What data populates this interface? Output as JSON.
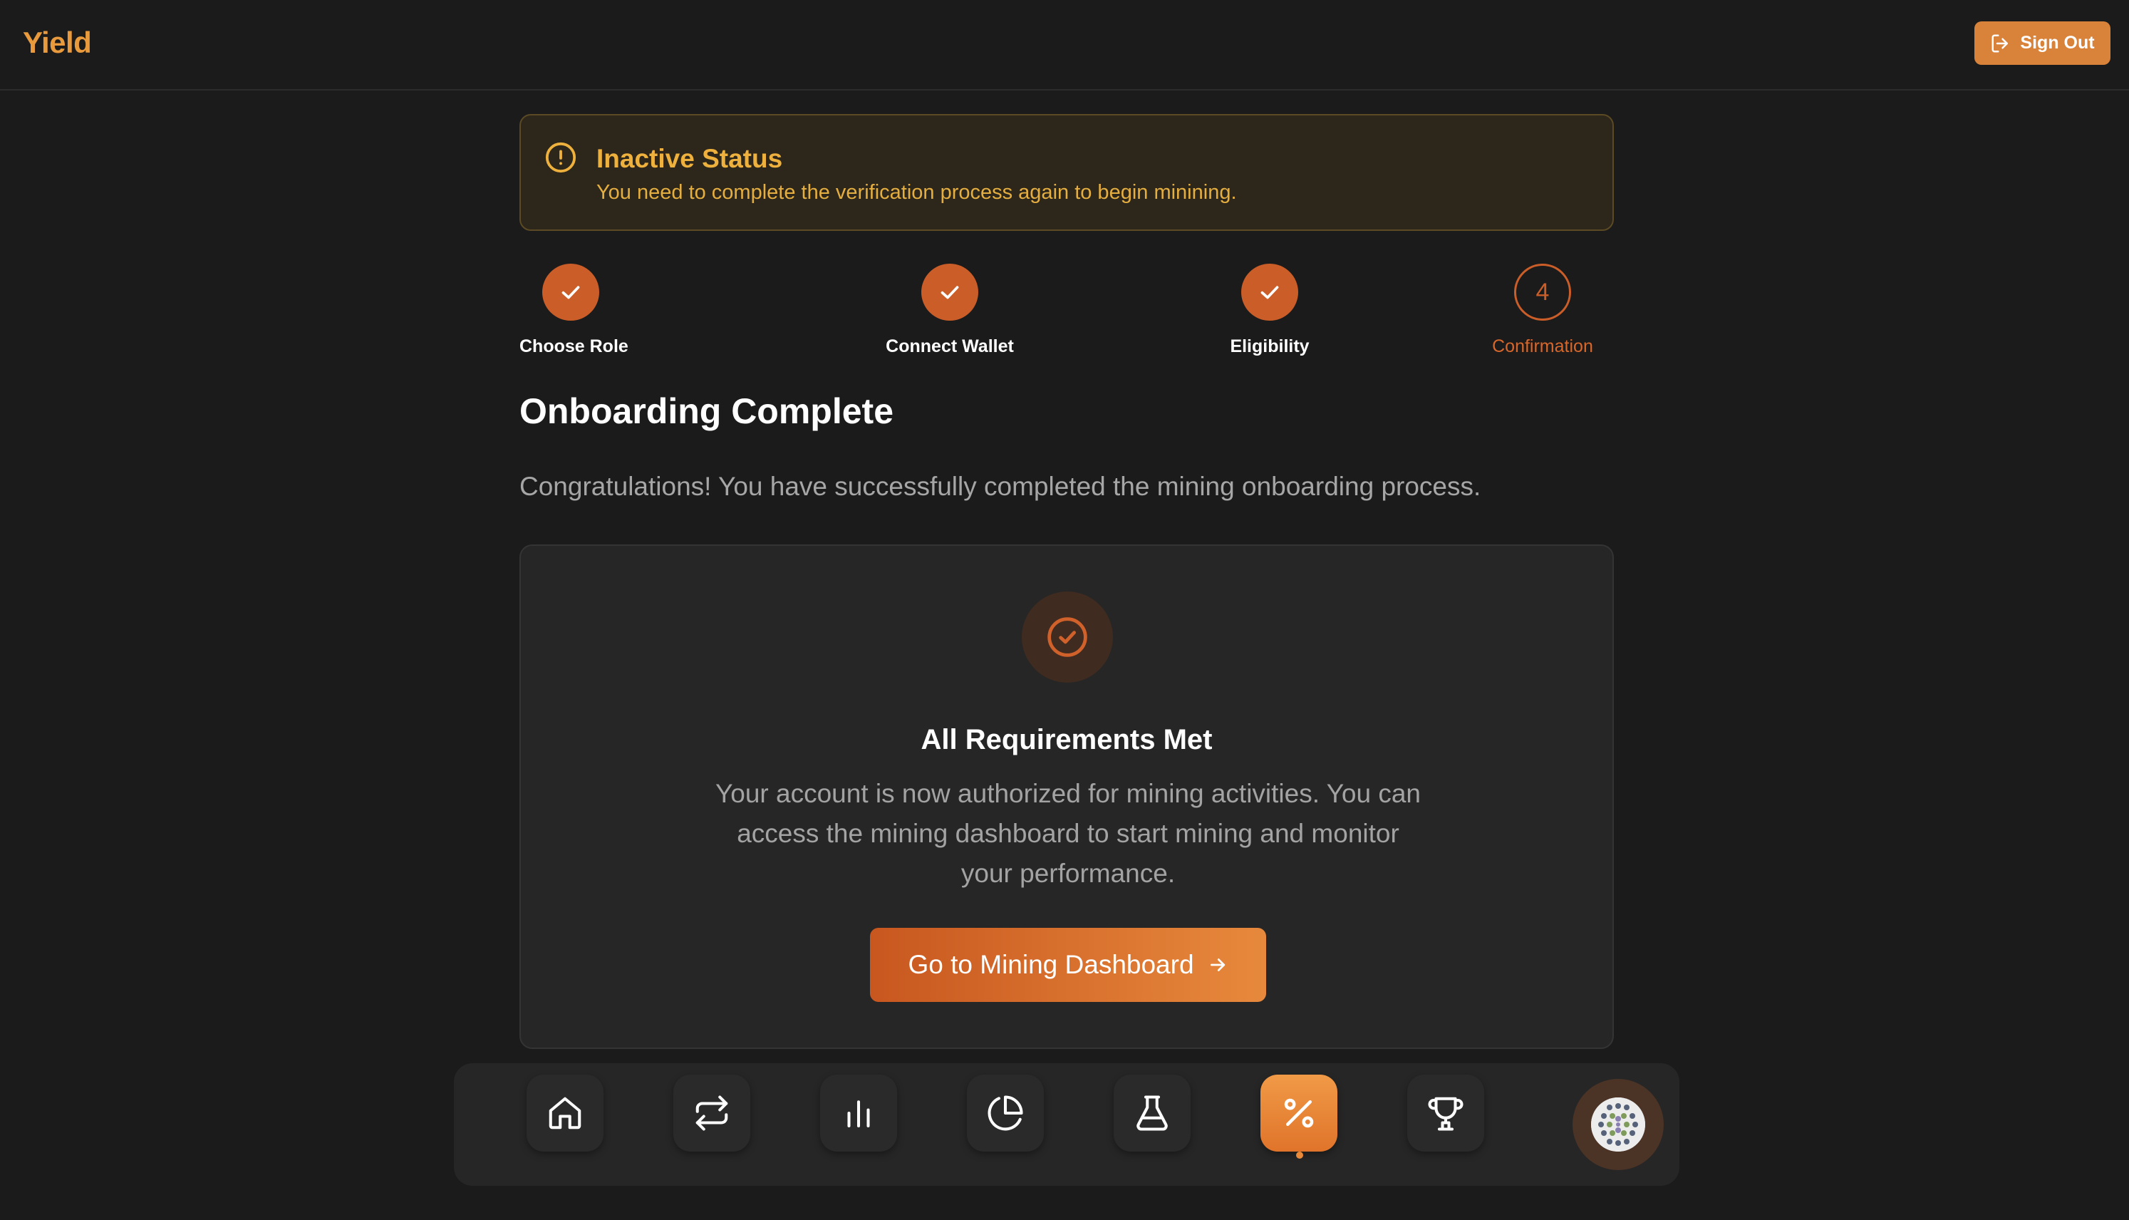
{
  "header": {
    "brand": "Yield",
    "sign_out_label": "Sign Out"
  },
  "alert": {
    "title": "Inactive Status",
    "message": "You need to complete the verification process again to begin minining.",
    "icon": "alert-circle-icon"
  },
  "stepper": {
    "steps": [
      {
        "label": "Choose Role",
        "status": "complete"
      },
      {
        "label": "Connect Wallet",
        "status": "complete"
      },
      {
        "label": "Eligibility",
        "status": "complete"
      },
      {
        "label": "Confirmation",
        "status": "current",
        "number": "4"
      }
    ]
  },
  "main": {
    "title": "Onboarding Complete",
    "subtitle": "Congratulations! You have successfully completed the mining onboarding process."
  },
  "card": {
    "title": "All Requirements Met",
    "body": "Your account is now authorized for mining activities. You can access the mining dashboard to start mining and monitor your performance.",
    "cta_label": "Go to Mining Dashboard"
  },
  "nav": {
    "items": [
      {
        "icon": "home-icon",
        "active": false
      },
      {
        "icon": "swap-arrows-icon",
        "active": false
      },
      {
        "icon": "bar-chart-icon",
        "active": false
      },
      {
        "icon": "pie-chart-icon",
        "active": false
      },
      {
        "icon": "flask-icon",
        "active": false
      },
      {
        "icon": "percent-icon",
        "active": true
      },
      {
        "icon": "trophy-icon",
        "active": false
      }
    ]
  },
  "colors": {
    "accent": "#d9823a",
    "accent_dark": "#cb5e28",
    "brand": "#e99a3c",
    "warning": "#eeb13d",
    "background": "#1b1b1b",
    "card": "#262626"
  }
}
